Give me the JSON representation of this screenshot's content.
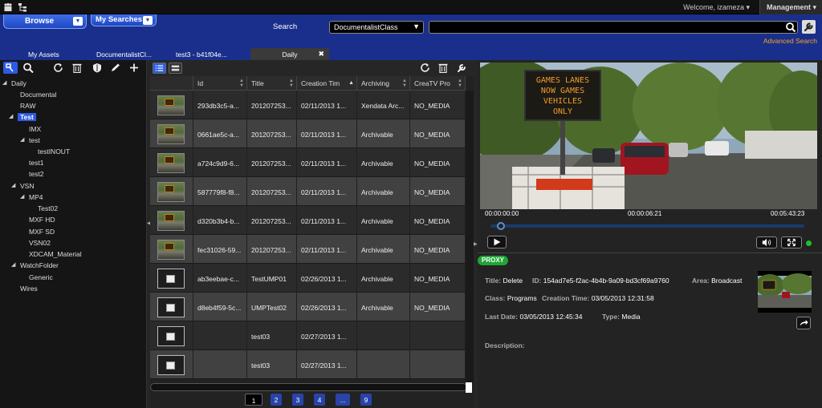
{
  "topbar": {
    "welcome": "Welcome, izameza ▾",
    "management": "Management ▾"
  },
  "header": {
    "browse_label": "Browse",
    "my_searches_label": "My Searches",
    "search_label": "Search",
    "class_selected": "DocumentalistClass",
    "search_value": "",
    "advanced_search": "Advanced Search"
  },
  "tabs": [
    {
      "label": "My Assets"
    },
    {
      "label": "DocumentalistCl..."
    },
    {
      "label": "test3 - b41f04e..."
    },
    {
      "label": "Daily",
      "close": "✖"
    }
  ],
  "tree": [
    {
      "label": "Daily"
    },
    {
      "label": "Documental"
    },
    {
      "label": "RAW"
    },
    {
      "label": "Test"
    },
    {
      "label": "IMX"
    },
    {
      "label": "test"
    },
    {
      "label": "testINOUT"
    },
    {
      "label": "test1"
    },
    {
      "label": "test2"
    },
    {
      "label": "VSN"
    },
    {
      "label": "MP4"
    },
    {
      "label": "Test02"
    },
    {
      "label": "MXF HD"
    },
    {
      "label": "MXF SD"
    },
    {
      "label": "VSN02"
    },
    {
      "label": "XDCAM_Material"
    },
    {
      "label": "WatchFolder"
    },
    {
      "label": "Generic"
    },
    {
      "label": "Wires"
    }
  ],
  "grid": {
    "columns": [
      "Id",
      "Title",
      "Creation Tim",
      "Archiving",
      "CreaTV Pro"
    ],
    "rows": [
      {
        "thumb": "image",
        "id": "293db3c5-a...",
        "title": "201207253...",
        "created": "02/11/2013 1...",
        "archiving": "Xendata Arc...",
        "creatv": "NO_MEDIA"
      },
      {
        "thumb": "image",
        "id": "0661ae5c-a...",
        "title": "201207253...",
        "created": "02/11/2013 1...",
        "archiving": "Archivable",
        "creatv": "NO_MEDIA"
      },
      {
        "thumb": "image",
        "id": "a724c9d9-6...",
        "title": "201207253...",
        "created": "02/11/2013 1...",
        "archiving": "Archivable",
        "creatv": "NO_MEDIA"
      },
      {
        "thumb": "image",
        "id": "587779f8-f8...",
        "title": "201207253...",
        "created": "02/11/2013 1...",
        "archiving": "Archivable",
        "creatv": "NO_MEDIA"
      },
      {
        "thumb": "image",
        "id": "d320b3b4-b...",
        "title": "201207253...",
        "created": "02/11/2013 1...",
        "archiving": "Archivable",
        "creatv": "NO_MEDIA"
      },
      {
        "thumb": "image",
        "id": "fec31026-59...",
        "title": "201207253...",
        "created": "02/11/2013 1...",
        "archiving": "Archivable",
        "creatv": "NO_MEDIA"
      },
      {
        "thumb": "blank",
        "id": "ab3eebae-c...",
        "title": "TestUMP01",
        "created": "02/26/2013 1...",
        "archiving": "Archivable",
        "creatv": "NO_MEDIA"
      },
      {
        "thumb": "blank",
        "id": "d8eb4f59-5c...",
        "title": "UMPTest02",
        "created": "02/26/2013 1...",
        "archiving": "Archivable",
        "creatv": "NO_MEDIA"
      },
      {
        "thumb": "blank",
        "id": "",
        "title": "test03",
        "created": "02/27/2013 1...",
        "archiving": "",
        "creatv": ""
      },
      {
        "thumb": "blank",
        "id": "",
        "title": "test03",
        "created": "02/27/2013 1...",
        "archiving": "",
        "creatv": ""
      }
    ]
  },
  "pagination": [
    "1",
    "2",
    "3",
    "4",
    "...",
    "9"
  ],
  "player": {
    "sign_text": [
      "GAMES LANES",
      "NOW GAMES",
      "VEHICLES",
      "ONLY"
    ],
    "time_start": "00:00:00:00",
    "time_current": "00:00:06:21",
    "time_end": "00:05:43:23",
    "progress": 0.02
  },
  "detail": {
    "badge": "PROXY",
    "title_k": "Title:",
    "title_v": "Delete",
    "id_k": "ID:",
    "id_v": "154ad7e5-f2ac-4b4b-9a09-bd3cf69a9760",
    "area_k": "Area:",
    "area_v": "Broadcast",
    "class_k": "Class:",
    "class_v": "Programs",
    "ctime_k": "Creation Time:",
    "ctime_v": "03/05/2013 12:31:58",
    "ldate_k": "Last Date:",
    "ldate_v": "03/05/2013 12:45:34",
    "type_k": "Type:",
    "type_v": "Media",
    "desc_k": "Description:"
  },
  "colors": {
    "header_blue": "#1a2f8c",
    "accent_orange": "#f5a623",
    "proxy_green": "#1fa534",
    "selection_blue": "#2d5be3"
  }
}
